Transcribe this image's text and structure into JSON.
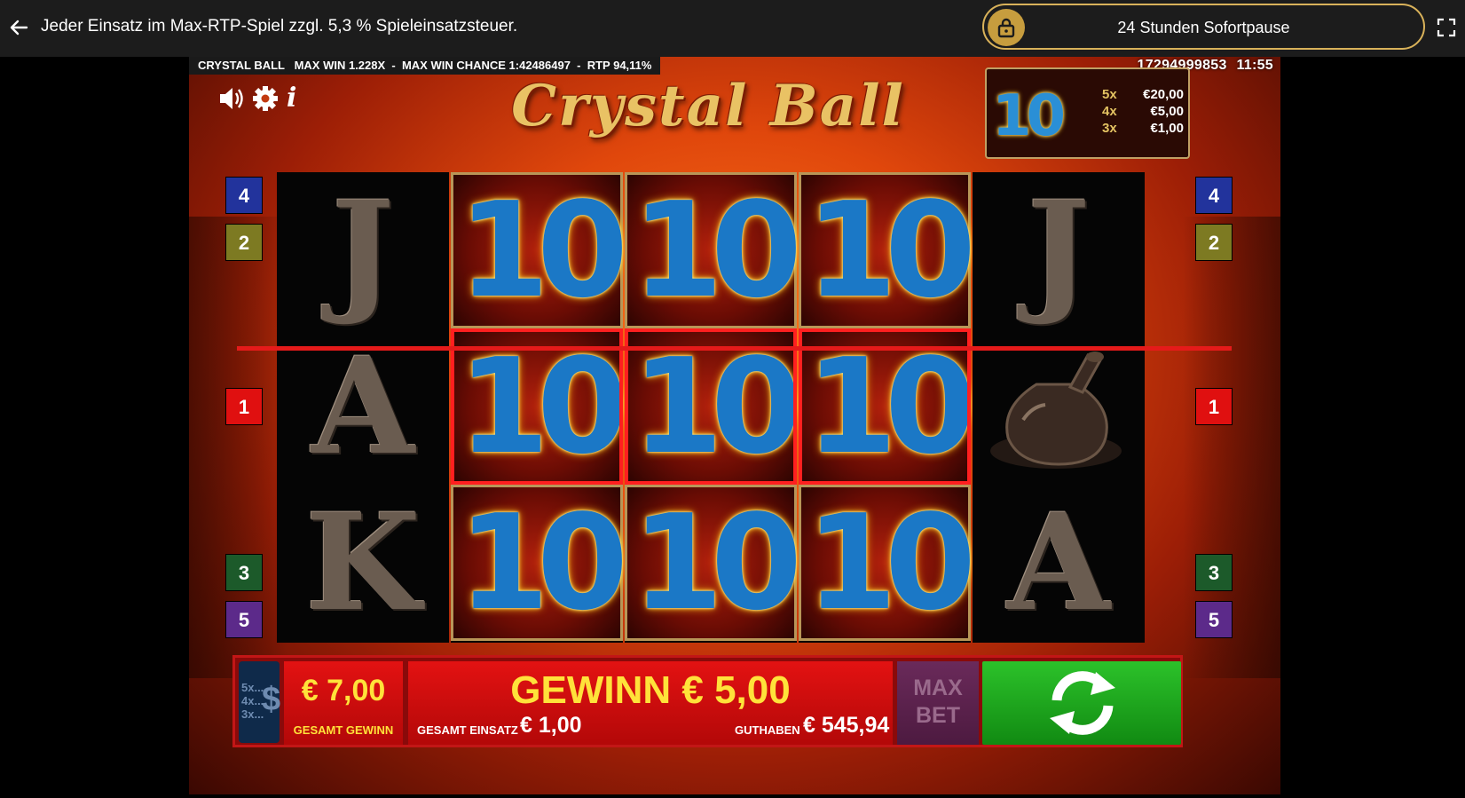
{
  "topbar": {
    "notice": "Jeder Einsatz im Max-RTP-Spiel zzgl. 5,3 % Spieleinsatzsteuer.",
    "pause_label": "24 Stunden Sofortpause",
    "icons": [
      "back-arrow-icon",
      "lock-icon",
      "fullscreen-icon"
    ]
  },
  "game": {
    "info_strip": "CRYSTAL BALL   MAX WIN 1.228X  -  MAX WIN CHANCE 1:42486497  -  RTP 94,11%",
    "session_id": "17294999853",
    "clock": "11:55",
    "title": "Crystal Ball",
    "controls": [
      "sound-icon",
      "settings-icon",
      "info-icon"
    ],
    "info_glyph": "i",
    "paytable": {
      "symbol": "10",
      "rows": [
        {
          "mult": "5x",
          "value": "€20,00"
        },
        {
          "mult": "4x",
          "value": "€5,00"
        },
        {
          "mult": "3x",
          "value": "€1,00"
        }
      ]
    },
    "reels": [
      [
        "J",
        "A",
        "K"
      ],
      [
        "10",
        "10",
        "10"
      ],
      [
        "10",
        "10",
        "10"
      ],
      [
        "10",
        "10",
        "10"
      ],
      [
        "J",
        "potion",
        "A"
      ]
    ],
    "winning_row": 1,
    "line_markers": {
      "left": [
        {
          "n": "4",
          "color": "#22339c"
        },
        {
          "n": "2",
          "color": "#7d7a22"
        },
        {
          "n": "1",
          "color": "#e01010"
        },
        {
          "n": "3",
          "color": "#1c5a2a"
        },
        {
          "n": "5",
          "color": "#5c2a8a"
        }
      ],
      "right": [
        {
          "n": "4",
          "color": "#22339c"
        },
        {
          "n": "2",
          "color": "#7d7a22"
        },
        {
          "n": "1",
          "color": "#e01010"
        },
        {
          "n": "3",
          "color": "#1c5a2a"
        },
        {
          "n": "5",
          "color": "#5c2a8a"
        }
      ]
    }
  },
  "panel": {
    "coins_lines": [
      "5x...",
      "4x...",
      "3x..."
    ],
    "coins_symbol": "$",
    "total_win_amount": "€ 7,00",
    "total_win_label": "GESAMT GEWINN",
    "win_text": "GEWINN € 5,00",
    "stake_label": "GESAMT EINSATZ",
    "stake_value": "€ 1,00",
    "balance_label": "GUTHABEN",
    "balance_value": "€ 545,94",
    "maxbet_line1": "MAX",
    "maxbet_line2": "BET"
  }
}
